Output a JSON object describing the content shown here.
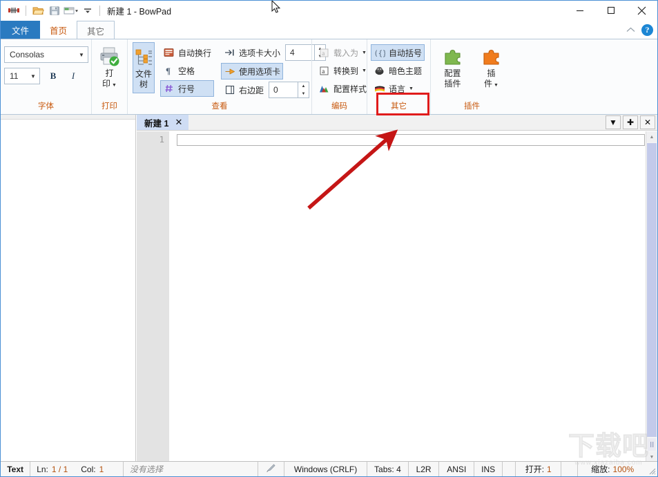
{
  "window": {
    "title": "新建 1 - BowPad",
    "quick_access": [
      {
        "name": "bowpad-logo-icon",
        "label": "BowPad"
      },
      {
        "name": "open-file-icon",
        "label": "打开"
      },
      {
        "name": "save-file-icon",
        "label": "保存"
      },
      {
        "name": "new-window-icon",
        "label": "新窗口"
      },
      {
        "name": "customize-qat-icon",
        "label": "自定义快速访问工具栏"
      }
    ],
    "controls": {
      "minimize": "最小化",
      "maximize": "最大化",
      "close": "关闭"
    }
  },
  "ribbon": {
    "tabs": [
      {
        "label": "文件",
        "state": "file"
      },
      {
        "label": "首页",
        "state": "normal"
      },
      {
        "label": "其它",
        "state": "active"
      }
    ],
    "collapse_label": "^",
    "help_label": "?",
    "groups": [
      {
        "label": "字体",
        "font_name": "Consolas",
        "font_size": "11",
        "bold": "B",
        "italic": "I"
      },
      {
        "label": "打印",
        "print_label_line1": "打",
        "print_label_line2": "印"
      },
      {
        "label": "查看",
        "filetree_line1": "文件",
        "filetree_line2": "树",
        "wordwrap": "自动换行",
        "whitespace": "空格",
        "linenumbers": "行号",
        "tabsize": "选项卡大小",
        "tabsize_value": "4",
        "usetabs": "使用选项卡",
        "rightmargin": "右边距",
        "rightmargin_value": "0"
      },
      {
        "label": "编码",
        "loadas": "载入为",
        "convertto": "转换到",
        "configstyle": "配置样式"
      },
      {
        "label": "其它",
        "autobrackets": "自动括号",
        "darktheme": "暗色主题",
        "language": "语言"
      },
      {
        "label": "插件",
        "config_line1": "配置",
        "config_line2": "插件",
        "plugin_line1": "插",
        "plugin_line2": "件"
      }
    ]
  },
  "document": {
    "tab_title": "新建 1",
    "tab_close": "✕",
    "tabstrip_buttons": [
      {
        "name": "tab-list-dropdown-button",
        "label": "▼"
      },
      {
        "name": "new-tab-button",
        "label": "✚"
      },
      {
        "name": "close-tab-button",
        "label": "✕"
      }
    ],
    "line_number": "1",
    "content": ""
  },
  "statusbar": {
    "doc_type": "Text",
    "line_label": "Ln:",
    "line_value": "1 / 1",
    "col_label": "Col:",
    "col_value": "1",
    "selection": "没有选择",
    "eol": "Windows (CRLF)",
    "tabs": "Tabs: 4",
    "direction": "L2R",
    "encoding": "ANSI",
    "insert_mode": "INS",
    "open_label": "打开:",
    "open_value": "1",
    "zoom_label": "缩放:",
    "zoom_value": "100%"
  },
  "annotations": {
    "highlight_box_target": "其它",
    "arrow_from": "编辑区",
    "arrow_to": "其它分组"
  },
  "watermark": {
    "text": "下载吧",
    "sub": "www.xiazaiba.com"
  },
  "colors": {
    "accent_blue": "#2a7ac0",
    "tab_orange": "#c85a10",
    "highlight_red": "#e01b1b",
    "active_tab_bg": "#cfddf4",
    "ribbon_bg": "#fbfcfd"
  }
}
